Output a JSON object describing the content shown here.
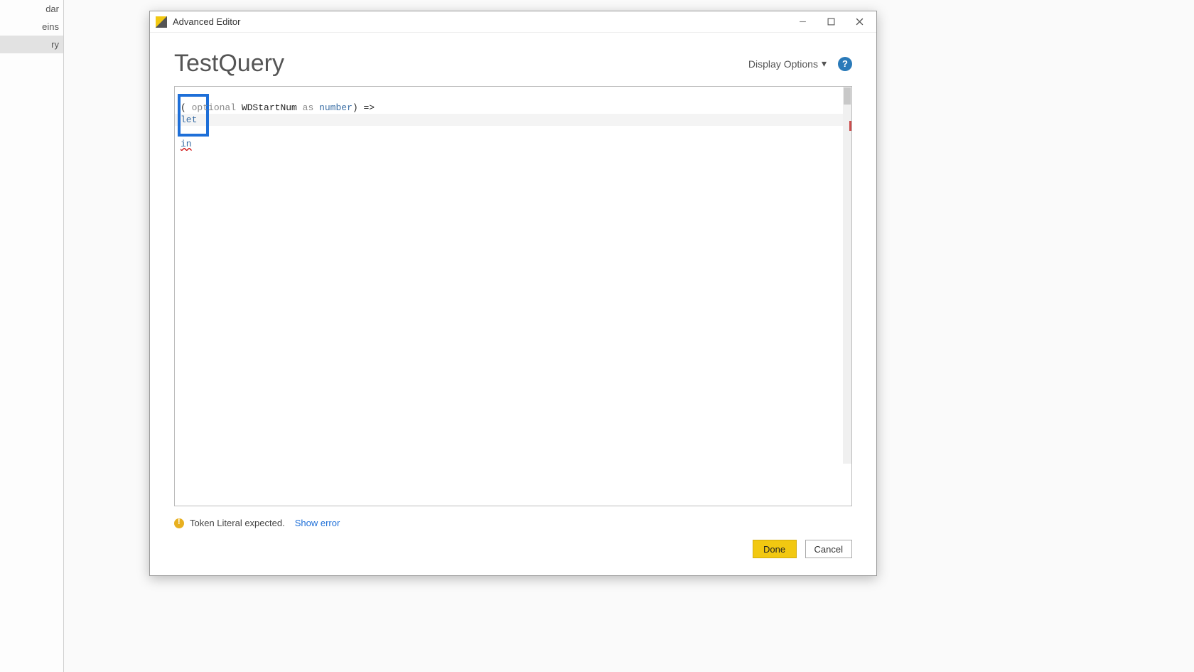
{
  "sidebar": {
    "items": [
      {
        "label": "dar"
      },
      {
        "label": "eins"
      },
      {
        "label": "ry"
      }
    ]
  },
  "window": {
    "title": "Advanced Editor"
  },
  "header": {
    "query_name": "TestQuery",
    "display_options": "Display Options"
  },
  "code": {
    "line1_prefix": "( ",
    "line1_kw1": "optional",
    "line1_ident": " WDStartNum ",
    "line1_kw2": "as",
    "line1_type": " number",
    "line1_suffix": ") =>",
    "line2": "let",
    "line3": "",
    "line4": "in"
  },
  "status": {
    "error_text": "Token Literal expected.",
    "show_error": "Show error"
  },
  "buttons": {
    "done": "Done",
    "cancel": "Cancel"
  }
}
